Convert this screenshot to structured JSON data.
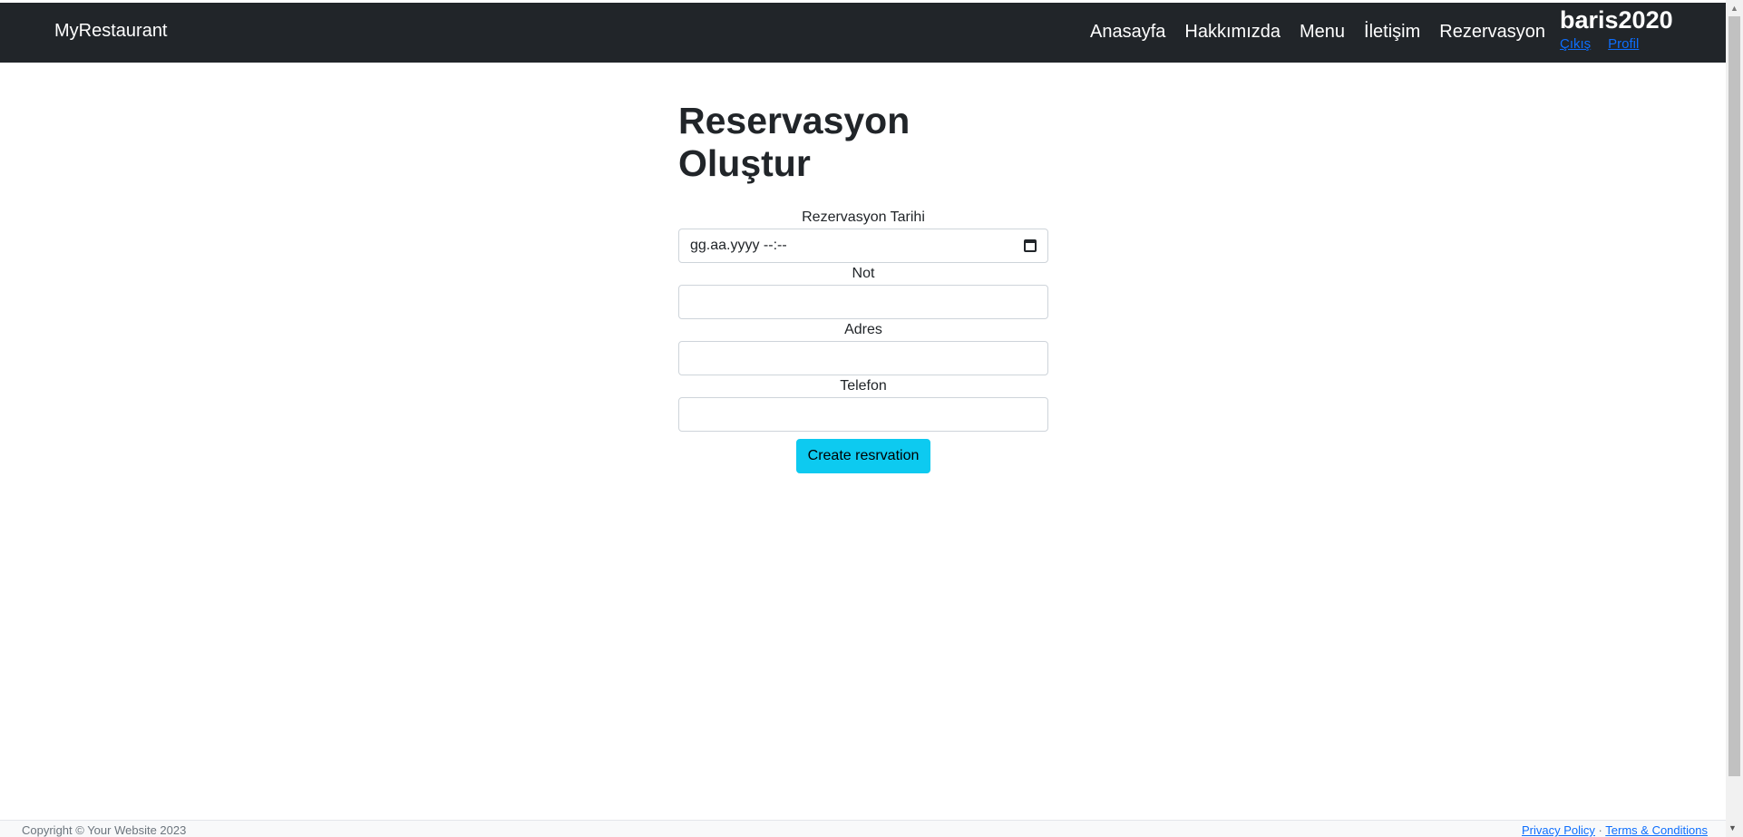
{
  "navbar": {
    "brand": "MyRestaurant",
    "links": [
      "Anasayfa",
      "Hakkımızda",
      "Menu",
      "İletişim",
      "Rezervasyon"
    ],
    "username": "baris2020",
    "user_links": [
      "Çıkış",
      "Profil"
    ]
  },
  "form": {
    "title": "Reservasyon Oluştur",
    "fields": [
      {
        "label": "Rezervasyon Tarihi",
        "value": "gg.aa.yyyy --:--"
      },
      {
        "label": "Not",
        "value": ""
      },
      {
        "label": "Adres",
        "value": ""
      },
      {
        "label": "Telefon",
        "value": ""
      }
    ],
    "submit_label": "Create resrvation"
  },
  "footer": {
    "copyright": "Copyright © Your Website 2023",
    "privacy": "Privacy Policy",
    "separator": "·",
    "terms": "Terms & Conditions"
  },
  "colors": {
    "navbar_bg": "#212529",
    "link": "#0d6efd",
    "button": "#0dcaf0"
  },
  "icons": {
    "calendar": "calendar-icon",
    "scroll_up": "triangle-up",
    "scroll_down": "triangle-down"
  }
}
